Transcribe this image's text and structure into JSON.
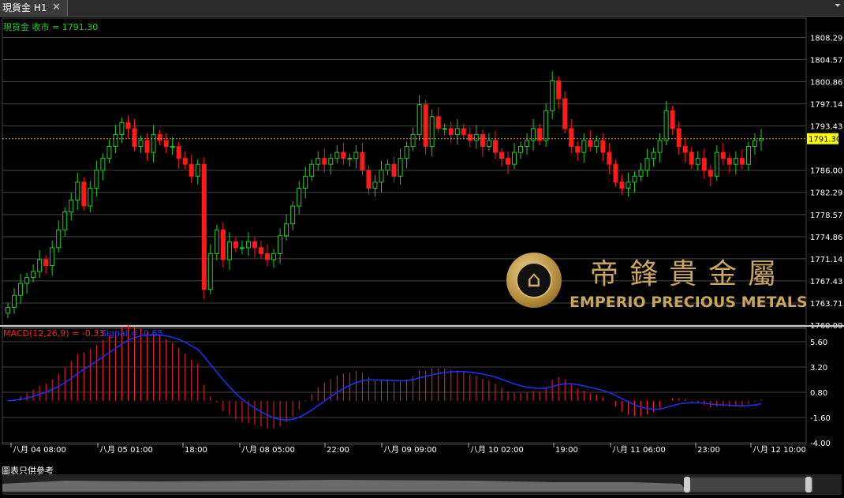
{
  "window": {
    "tab_title": "現貨金 H1",
    "close_glyph": "✕",
    "menu_glyph": "⏷"
  },
  "price_panel": {
    "label": "現貨金 收市 = 1791.30",
    "current_price": "1791.30",
    "axis_ticks": [
      1808.29,
      1804.57,
      1800.86,
      1797.14,
      1793.43,
      1786.0,
      1782.29,
      1778.57,
      1774.86,
      1771.14,
      1767.43,
      1763.71,
      1760.0
    ],
    "ylim": [
      1760.0,
      1811.0
    ]
  },
  "macd_panel": {
    "label": "MACD(12,26,9) = -0.33",
    "signal_label": "Signal = -0.65",
    "axis_ticks": [
      5.6,
      3.2,
      0.8,
      -1.6,
      -4.0
    ],
    "ylim": [
      -4.0,
      6.5
    ]
  },
  "time_axis": [
    "八月 04 08:00",
    "八月 05 01:00",
    "18:00",
    "八月 08 05:00",
    "22:00",
    "八月 09 09:00",
    "八月 10 02:00",
    "19:00",
    "八月 11 06:00",
    "23:00",
    "八月 12 10:00"
  ],
  "disclaimer": "圖表只供參考",
  "logo": {
    "cn": "帝鋒貴金屬",
    "en": "EMPERIO PRECIOUS METALS"
  },
  "colors": {
    "up": "#22cc22",
    "down": "#ff1a1a",
    "macd_hist": "#ff2020",
    "signal": "#2030ff",
    "price_line": "#e0a020",
    "bg": "#000000"
  },
  "chart_data": {
    "type": "candlestick",
    "series": [
      {
        "name": "現貨金"
      }
    ],
    "close": [
      1763,
      1765,
      1767,
      1768,
      1769,
      1771,
      1770,
      1773,
      1776,
      1779,
      1781,
      1784,
      1780,
      1783,
      1786,
      1788,
      1790,
      1792,
      1794,
      1793,
      1790,
      1791,
      1789,
      1792,
      1791,
      1790,
      1790,
      1788,
      1787,
      1785,
      1787,
      1766,
      1772,
      1776,
      1771,
      1774,
      1773,
      1773,
      1774,
      1773,
      1772,
      1771,
      1772,
      1775,
      1777,
      1780,
      1783,
      1785,
      1787,
      1788,
      1787,
      1788,
      1789,
      1788,
      1788,
      1789,
      1786,
      1783,
      1784,
      1786,
      1787,
      1785,
      1788,
      1790,
      1792,
      1797,
      1790,
      1795,
      1793,
      1793,
      1792,
      1793,
      1792,
      1791,
      1792,
      1790,
      1791,
      1789,
      1788,
      1787,
      1789,
      1790,
      1791,
      1793,
      1791,
      1796,
      1801,
      1798,
      1793,
      1790,
      1789,
      1791,
      1790,
      1791,
      1789,
      1787,
      1784,
      1783,
      1784,
      1785,
      1786,
      1788,
      1789,
      1791,
      1796,
      1793,
      1790,
      1789,
      1787,
      1788,
      1786,
      1785,
      1789,
      1788,
      1787,
      1788,
      1787,
      1790,
      1791,
      1791.3
    ]
  }
}
